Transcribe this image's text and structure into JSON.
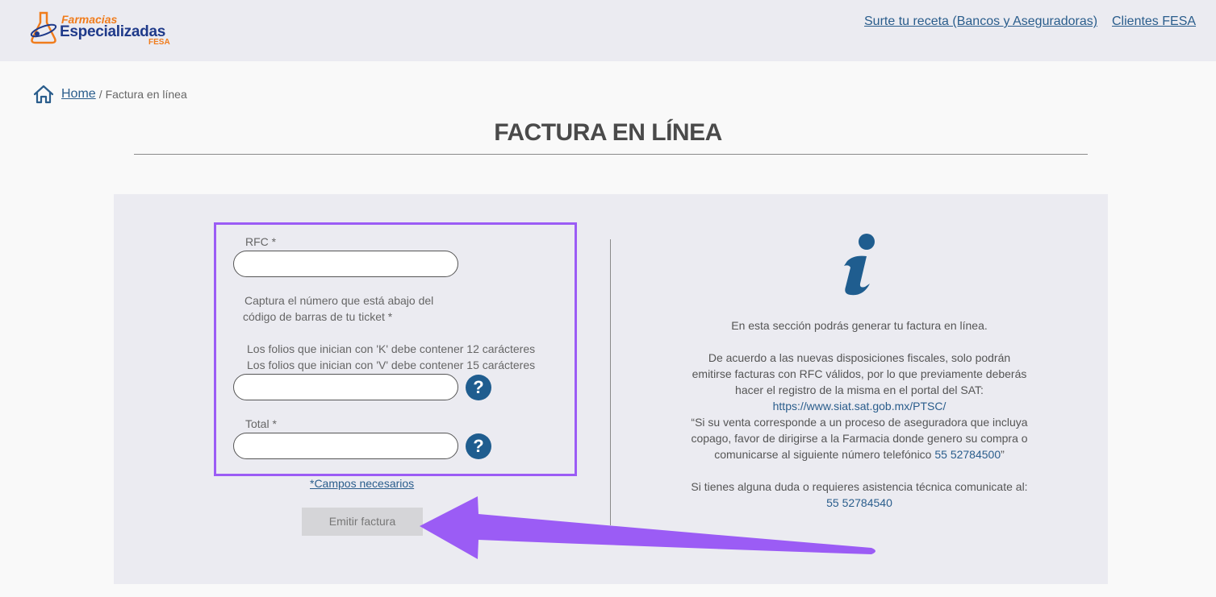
{
  "header": {
    "logo": {
      "line1": "Farmacias",
      "line2": "Especializadas",
      "line3": "FESA"
    },
    "nav": [
      {
        "label": "Surte tu receta (Bancos y Aseguradoras)"
      },
      {
        "label": "Clientes FESA"
      }
    ]
  },
  "breadcrumb": {
    "home": "Home",
    "separator": "/",
    "current": "Factura en línea"
  },
  "page": {
    "title": "FACTURA EN LÍNEA"
  },
  "form": {
    "rfc_label": "RFC *",
    "rfc_value": "",
    "ticket_label_line1": "Captura el número que está abajo del",
    "ticket_label_line2": "código de barras de tu ticket *",
    "folio_note_line1": "Los folios que inician con 'K' debe contener 12 carácteres",
    "folio_note_line2": "Los folios que inician con 'V' debe contener 15 carácteres",
    "ticket_value": "",
    "total_label": "Total *",
    "total_value": "",
    "help_glyph": "?",
    "required_note": "*Campos necesarios",
    "submit_label": "Emitir factura"
  },
  "info": {
    "icon": "info-icon",
    "intro": "En esta sección podrás generar tu factura en línea.",
    "p1_line1": "De acuerdo a las nuevas disposiciones fiscales, solo podrán",
    "p1_line2": "emitirse facturas con RFC válidos, por lo que previamente deberás",
    "p1_line3": "hacer el registro de la misma en el portal del SAT:",
    "sat_link": "https://www.siat.sat.gob.mx/PTSC/",
    "p2_line1": "“Si su venta corresponde a un proceso de aseguradora que incluya",
    "p2_line2": "copago, favor de dirigirse a la Farmacia donde genero su compra o",
    "p2_line3": "comunicarse al siguiente número telefónico",
    "p2_phone": "55 52784500",
    "p2_close": "”",
    "p3_line1": "Si tienes alguna duda o requieres asistencia técnica comunicate al:",
    "p3_phone": "55 52784540"
  },
  "colors": {
    "accent": "#9b5cf5",
    "brand_blue": "#1f5d8f",
    "brand_orange": "#f07c1c",
    "panel": "#ebebf1"
  }
}
